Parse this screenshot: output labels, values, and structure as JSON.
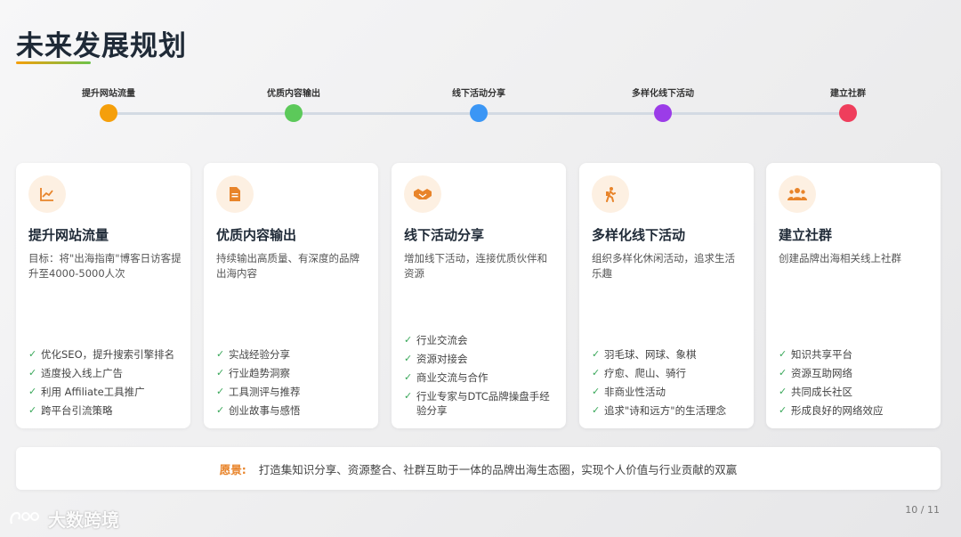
{
  "page_title": "未来发展规划",
  "timeline": [
    {
      "label": "提升网站流量",
      "color": "#f59f0b"
    },
    {
      "label": "优质内容输出",
      "color": "#5cc95a"
    },
    {
      "label": "线下活动分享",
      "color": "#3b96f5"
    },
    {
      "label": "多样化线下活动",
      "color": "#9b3ce8"
    },
    {
      "label": "建立社群",
      "color": "#ef3e5c"
    }
  ],
  "cards": [
    {
      "icon": "chart-line-icon",
      "title": "提升网站流量",
      "desc": "目标：将\"出海指南\"博客日访客提升至4000-5000人次",
      "items": [
        "优化SEO，提升搜索引擎排名",
        "适度投入线上广告",
        "利用 Affiliate工具推广",
        "跨平台引流策略"
      ]
    },
    {
      "icon": "document-icon",
      "title": "优质内容输出",
      "desc": "持续输出高质量、有深度的品牌出海内容",
      "items": [
        "实战经验分享",
        "行业趋势洞察",
        "工具测评与推荐",
        "创业故事与感悟"
      ]
    },
    {
      "icon": "handshake-icon",
      "title": "线下活动分享",
      "desc": "增加线下活动，连接优质伙伴和资源",
      "items": [
        "行业交流会",
        "资源对接会",
        "商业交流与合作",
        "行业专家与DTC品牌操盘手经验分享"
      ]
    },
    {
      "icon": "hiking-icon",
      "title": "多样化线下活动",
      "desc": "组织多样化休闲活动，追求生活乐趣",
      "items": [
        "羽毛球、网球、象棋",
        "疗愈、爬山、骑行",
        "非商业性活动",
        "追求\"诗和远方\"的生活理念"
      ]
    },
    {
      "icon": "community-icon",
      "title": "建立社群",
      "desc": "创建品牌出海相关线上社群",
      "items": [
        "知识共享平台",
        "资源互助网络",
        "共同成长社区",
        "形成良好的网络效应"
      ]
    }
  ],
  "vision": {
    "label": "愿景:",
    "text": "打造集知识分享、资源整合、社群互助于一体的品牌出海生态圈，实现个人价值与行业贡献的双赢"
  },
  "page_number": "10 / 11",
  "watermark": "大数跨境",
  "accent_color": "#f59f0b"
}
